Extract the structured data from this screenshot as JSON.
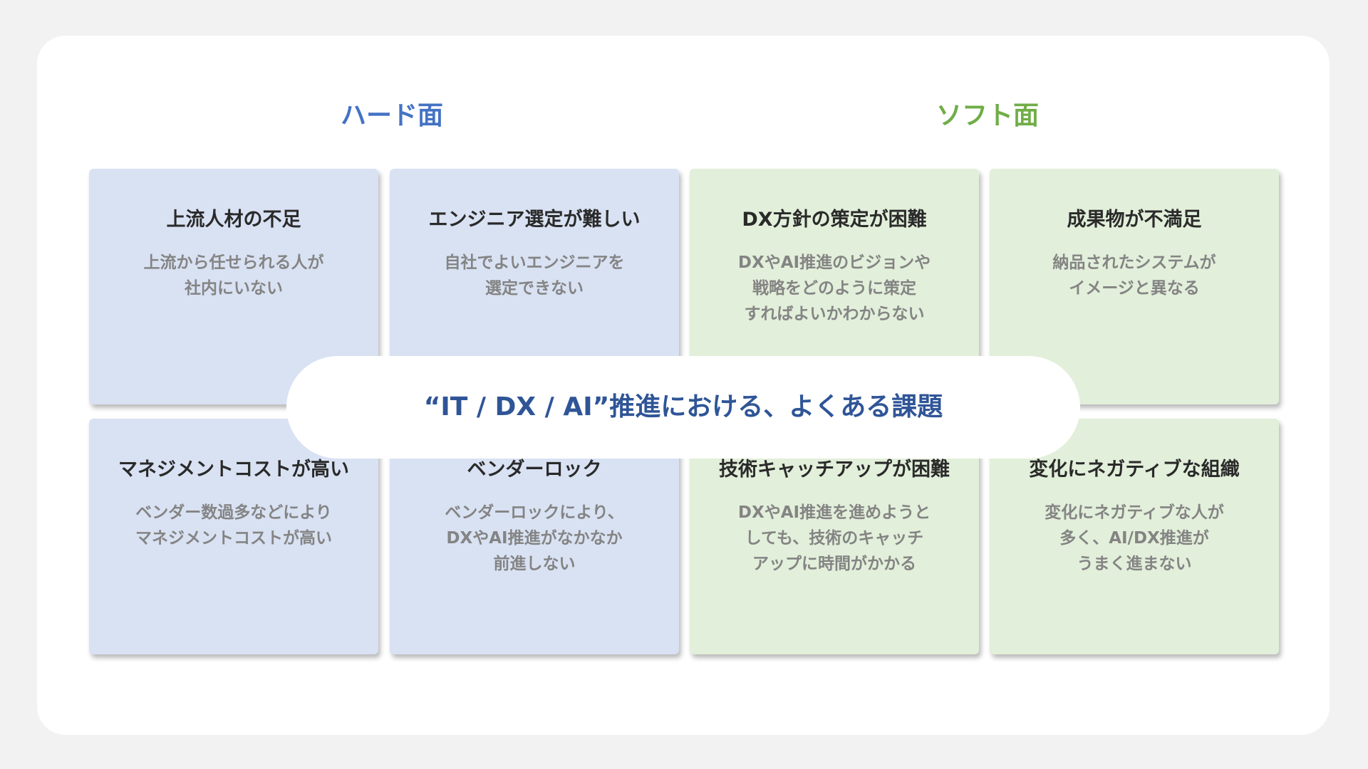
{
  "colors": {
    "hard_heading": "#4472c4",
    "soft_heading": "#70ad47",
    "hard_card_bg": "#d9e2f3",
    "soft_card_bg": "#e2efda",
    "center_text": "#2f5597"
  },
  "headings": {
    "hard": "ハード面",
    "soft": "ソフト面"
  },
  "center_label": "“IT / DX / AI”推進における、よくある課題",
  "cards": [
    {
      "group": "hard",
      "title": "上流人材の不足",
      "desc": [
        "上流から任せられる人が",
        "社内にいない"
      ]
    },
    {
      "group": "hard",
      "title": "エンジニア選定が難しい",
      "desc": [
        "自社でよいエンジニアを",
        "選定できない"
      ]
    },
    {
      "group": "soft",
      "title": "DX方針の策定が困難",
      "desc": [
        "DXやAI推進のビジョンや",
        "戦略をどのように策定",
        "すればよいかわからない"
      ]
    },
    {
      "group": "soft",
      "title": "成果物が不満足",
      "desc": [
        "納品されたシステムが",
        "イメージと異なる"
      ]
    },
    {
      "group": "hard",
      "title": "マネジメントコストが高い",
      "desc": [
        "ベンダー数過多などにより",
        "マネジメントコストが高い"
      ]
    },
    {
      "group": "hard",
      "title": "ベンダーロック",
      "desc": [
        "ベンダーロックにより、",
        "DXやAI推進がなかなか",
        "前進しない"
      ]
    },
    {
      "group": "soft",
      "title": "技術キャッチアップが困難",
      "desc": [
        "DXやAI推進を進めようと",
        "しても、技術のキャッチ",
        "アップに時間がかかる"
      ]
    },
    {
      "group": "soft",
      "title": "変化にネガティブな組織",
      "desc": [
        "変化にネガティブな人が",
        "多く、AI/DX推進が",
        "うまく進まない"
      ]
    }
  ]
}
